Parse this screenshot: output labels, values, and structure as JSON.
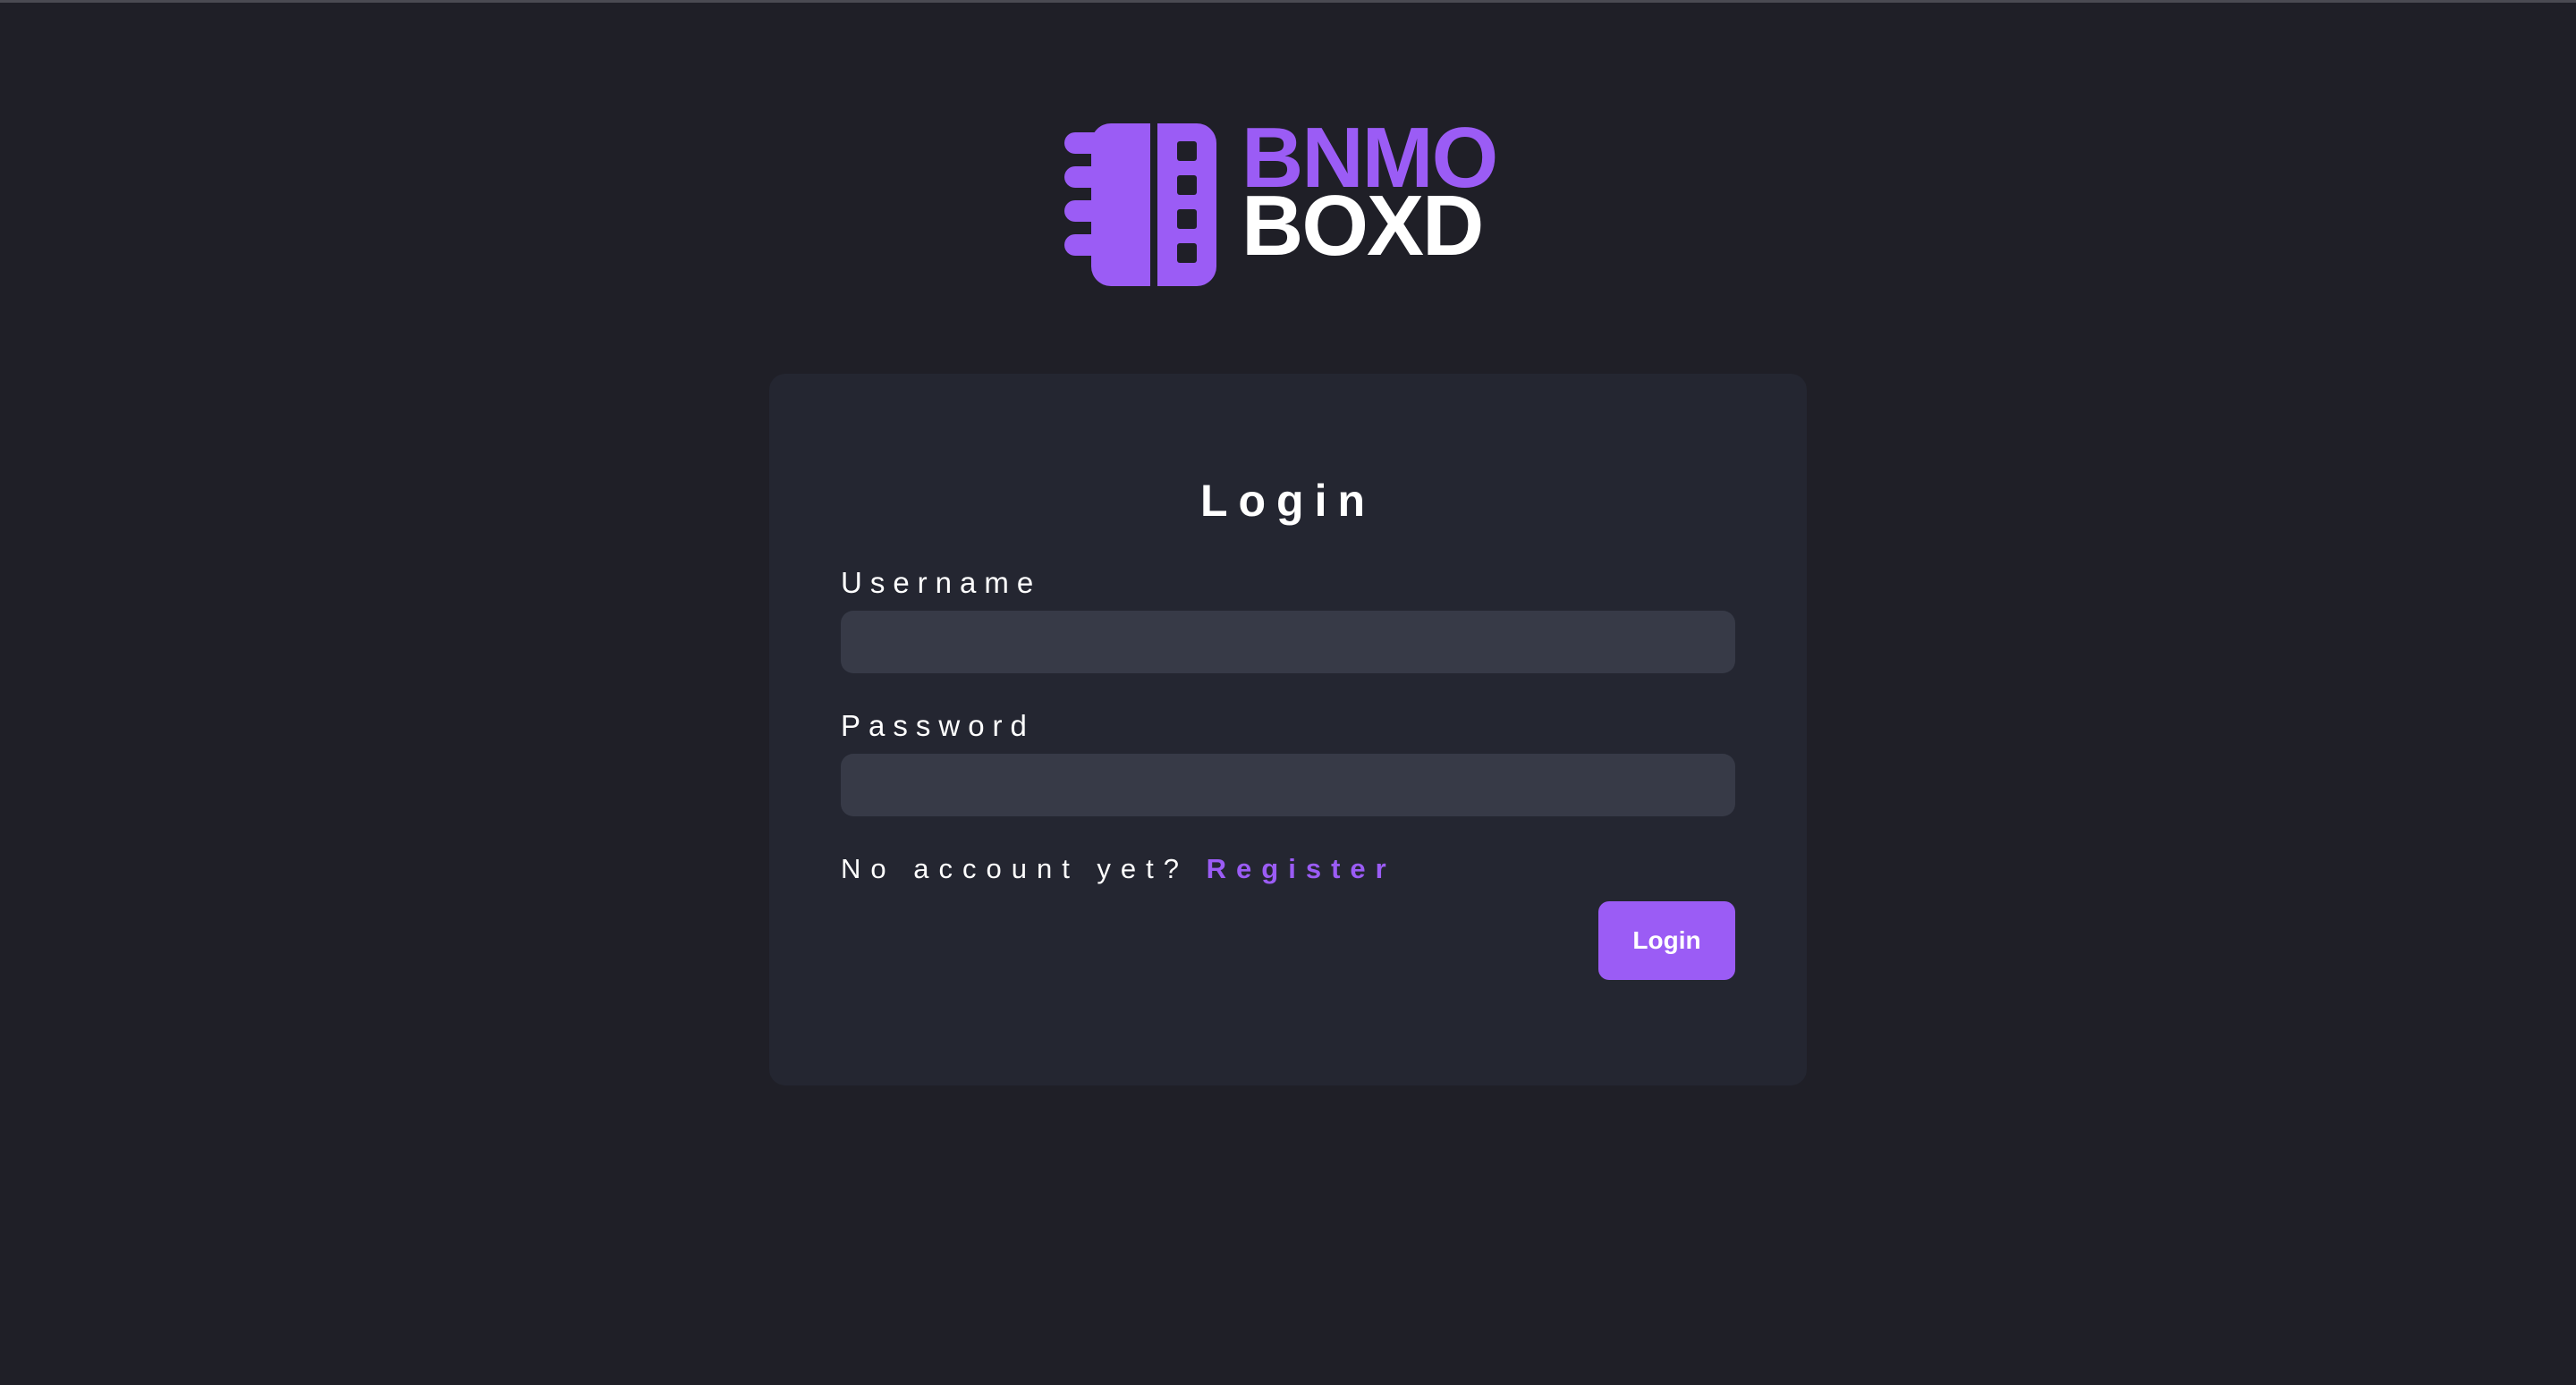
{
  "brand": {
    "line1": "BNMO",
    "line2": "BOXD",
    "accent_color": "#9b5cf5",
    "logo_icon": "film-strip-icon"
  },
  "login_form": {
    "title": "Login",
    "username_label": "Username",
    "username_value": "",
    "password_label": "Password",
    "password_value": "",
    "register_prompt": "No account yet?",
    "register_link": "Register",
    "submit_label": "Login"
  },
  "colors": {
    "background": "#1f1f27",
    "card": "#242631",
    "input": "#373a47",
    "accent": "#9b5cf5",
    "text": "#ffffff"
  }
}
